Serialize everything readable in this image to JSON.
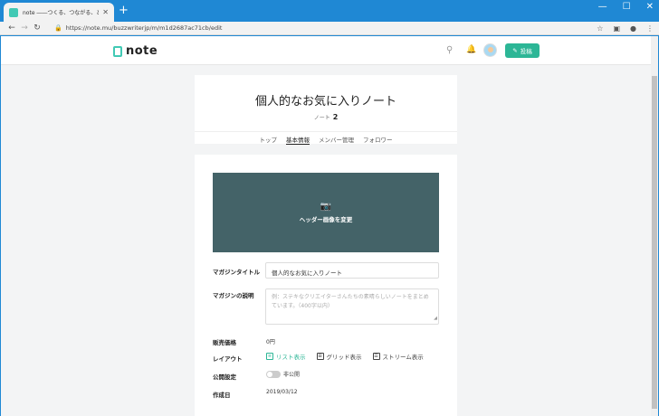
{
  "browser": {
    "tab_title": "note ――つくる、つながる、とどける。",
    "tab_close": "✕",
    "new_tab": "+",
    "win_min": "—",
    "win_max": "☐",
    "win_close": "✕",
    "url": "https://note.mu/buzzwriterjp/m/m1d2687ac71cb/edit"
  },
  "header": {
    "logo_text": "note",
    "post_button_label": "投稿"
  },
  "magazine": {
    "title": "個人的なお気に入りノート",
    "note_label": "ノート",
    "note_count": "2",
    "tabs": [
      {
        "label": "トップ"
      },
      {
        "label": "基本情報"
      },
      {
        "label": "メンバー管理"
      },
      {
        "label": "フォロワー"
      }
    ]
  },
  "form": {
    "header_image_label": "ヘッダー画像を変更",
    "title_label": "マガジンタイトル",
    "title_value": "個人的なお気に入りノート",
    "desc_label": "マガジンの説明",
    "desc_placeholder": "例：ステキなクリエイターさんたちの素晴らしいノートをまとめています。（400字以内）",
    "price_label": "販売価格",
    "price_value": "0円",
    "layout_label": "レイアウト",
    "layout_options": [
      {
        "label": "リスト表示"
      },
      {
        "label": "グリッド表示"
      },
      {
        "label": "ストリーム表示"
      }
    ],
    "visibility_label": "公開設定",
    "visibility_value": "非公開",
    "created_label": "作成日",
    "created_value": "2019/03/12"
  },
  "colors": {
    "accent": "#2cb696",
    "chrome": "#1f88d4",
    "hero": "#446368"
  }
}
